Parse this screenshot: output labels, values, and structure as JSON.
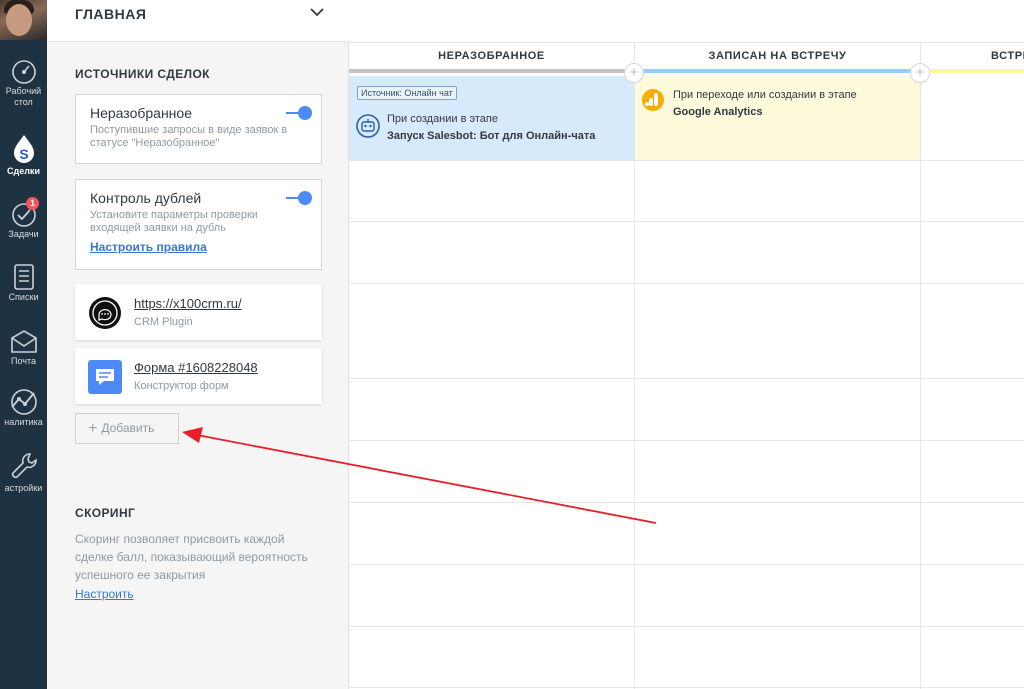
{
  "nav": {
    "items": [
      {
        "label": "Рабочий",
        "label2": "стол",
        "icon": "dashboard-icon"
      },
      {
        "label": "Сделки",
        "icon": "deals-icon"
      },
      {
        "label": "Задачи",
        "icon": "tasks-icon",
        "badge": "1"
      },
      {
        "label": "Списки",
        "icon": "lists-icon"
      },
      {
        "label": "Почта",
        "icon": "mail-icon"
      },
      {
        "label": "налитика",
        "icon": "analytics-icon"
      },
      {
        "label": "астройки",
        "icon": "settings-icon"
      }
    ]
  },
  "panel": {
    "header_title": "ГЛАВНАЯ",
    "sources_title": "ИСТОЧНИКИ СДЕЛОК",
    "unsorted": {
      "name": "Неразобранное",
      "desc": "Поступившие запросы в виде заявок в статусе \"Неразобранное\""
    },
    "duplicates": {
      "name": "Контроль дублей",
      "desc": "Установите параметры проверки входящей заявки на дубль",
      "link": "Настроить правила"
    },
    "integrations": [
      {
        "title": "https://x100crm.ru/",
        "subtitle": "CRM Plugin"
      },
      {
        "title": "Форма #1608228048",
        "subtitle": "Конструктор форм"
      }
    ],
    "add_label": "Добавить",
    "scoring_title": "СКОРИНГ",
    "scoring_desc": "Скоринг позволяет присвоить каждой сделке балл, показывающий вероятность успешного ее закрытия",
    "scoring_link": "Настроить"
  },
  "pipeline": {
    "columns": [
      {
        "title": "НЕРАЗОБРАННОЕ",
        "color": "#c4c4c4"
      },
      {
        "title": "ЗАПИСАН НА ВСТРЕЧУ",
        "color": "#99ccff"
      },
      {
        "title": "ВСТРЕ",
        "color": "#fff799"
      }
    ],
    "trigger1": {
      "tag": "Источник: Онлайн чат",
      "line1": "При создании в этапе",
      "line2": "Запуск Salesbot: Бот для Онлайн-чата"
    },
    "trigger2": {
      "line1": "При переходе или создании в этапе",
      "line2": "Google Analytics"
    }
  },
  "colors": {
    "nav_bg": "#1f3242",
    "accent": "#4c8bf5",
    "arrow": "#e8202a"
  }
}
